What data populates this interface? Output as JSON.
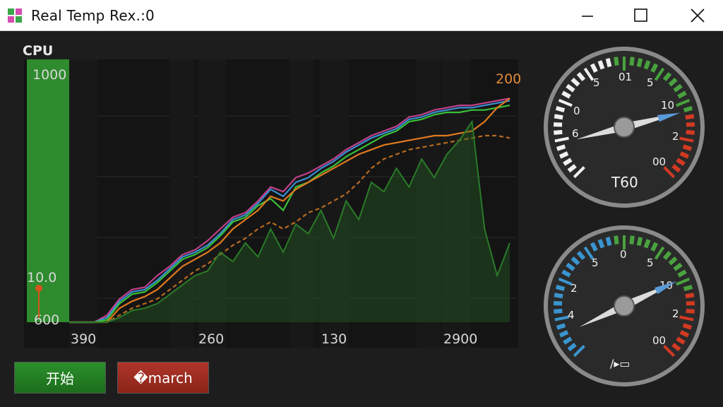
{
  "window": {
    "title": "Real Temp  Rex.:0",
    "icon": "app-grid-icon"
  },
  "chart": {
    "title": "CPU",
    "y_top_label": "1000",
    "y_mid_label": "10.0",
    "y_bottom_label": "600",
    "peak_label": "200",
    "x_ticks": [
      "390",
      "260",
      "130",
      "2900"
    ]
  },
  "chart_data": {
    "type": "line",
    "title": "CPU",
    "x_tick_labels": [
      "390",
      "260",
      "130",
      "2900"
    ],
    "y_tick_labels": [
      "1000",
      "10.0",
      "600"
    ],
    "peak_annotation": "200",
    "series": [
      {
        "color": "#c2408a",
        "values": [
          0,
          0,
          0,
          3,
          10,
          14,
          15,
          20,
          24,
          29,
          31,
          35,
          40,
          45,
          47,
          52,
          58,
          56,
          62,
          64,
          67,
          70,
          74,
          77,
          80,
          82,
          84,
          88,
          89,
          91,
          92,
          93,
          93,
          94,
          95,
          96
        ]
      },
      {
        "color": "#3a8fd0",
        "values": [
          0,
          0,
          0,
          2,
          9,
          13,
          14,
          18,
          23,
          28,
          30,
          33,
          38,
          44,
          46,
          51,
          57,
          54,
          60,
          62,
          66,
          69,
          73,
          76,
          79,
          81,
          83,
          87,
          88,
          90,
          91,
          92,
          92,
          93,
          94,
          95
        ]
      },
      {
        "color": "#38c038",
        "values": [
          0,
          0,
          0,
          1,
          8,
          12,
          13,
          17,
          22,
          27,
          29,
          32,
          37,
          43,
          45,
          50,
          53,
          48,
          58,
          60,
          64,
          67,
          71,
          74,
          77,
          80,
          82,
          86,
          87,
          89,
          90,
          90,
          91,
          91,
          92,
          93
        ]
      },
      {
        "color": "#e07a20",
        "values": [
          0,
          0,
          0,
          0,
          6,
          9,
          11,
          14,
          19,
          24,
          27,
          30,
          34,
          40,
          44,
          48,
          54,
          52,
          57,
          60,
          63,
          66,
          69,
          72,
          74,
          76,
          77,
          78,
          79,
          80,
          80,
          81,
          82,
          86,
          92,
          96
        ]
      },
      {
        "color": "#b86a20",
        "dashed": true,
        "values": [
          0,
          0,
          0,
          0,
          3,
          6,
          8,
          10,
          14,
          18,
          22,
          25,
          29,
          33,
          36,
          40,
          43,
          40,
          43,
          47,
          49,
          52,
          55,
          60,
          66,
          70,
          72,
          74,
          75,
          76,
          77,
          78,
          79,
          80,
          80,
          79
        ]
      },
      {
        "color": "#2a7a2a",
        "area": true,
        "values": [
          0,
          0,
          0,
          0,
          2,
          5,
          6,
          8,
          12,
          16,
          20,
          22,
          30,
          26,
          34,
          28,
          40,
          30,
          42,
          38,
          48,
          36,
          52,
          44,
          60,
          56,
          66,
          58,
          70,
          62,
          72,
          78,
          86,
          40,
          20,
          34
        ]
      }
    ],
    "grid": true,
    "legend": "none"
  },
  "gauges": {
    "top": {
      "label": "T60",
      "ticks": [
        "6",
        "0",
        "5",
        "01",
        "5",
        "10",
        "2",
        "00"
      ],
      "needle_fraction": 0.78,
      "cold_color": "#f0f0f0",
      "mid_color": "#49a23f",
      "hot_color": "#d23a22"
    },
    "bottom": {
      "label": "/▸▭",
      "ticks": [
        "4",
        "2",
        "5",
        "0",
        "5",
        "10",
        "2",
        "00"
      ],
      "needle_fraction": 0.74,
      "cold_color": "#3a95cf",
      "mid_color": "#49a23f",
      "hot_color": "#d23a22"
    }
  },
  "buttons": {
    "start_label": "开始",
    "stop_label": "�march"
  }
}
